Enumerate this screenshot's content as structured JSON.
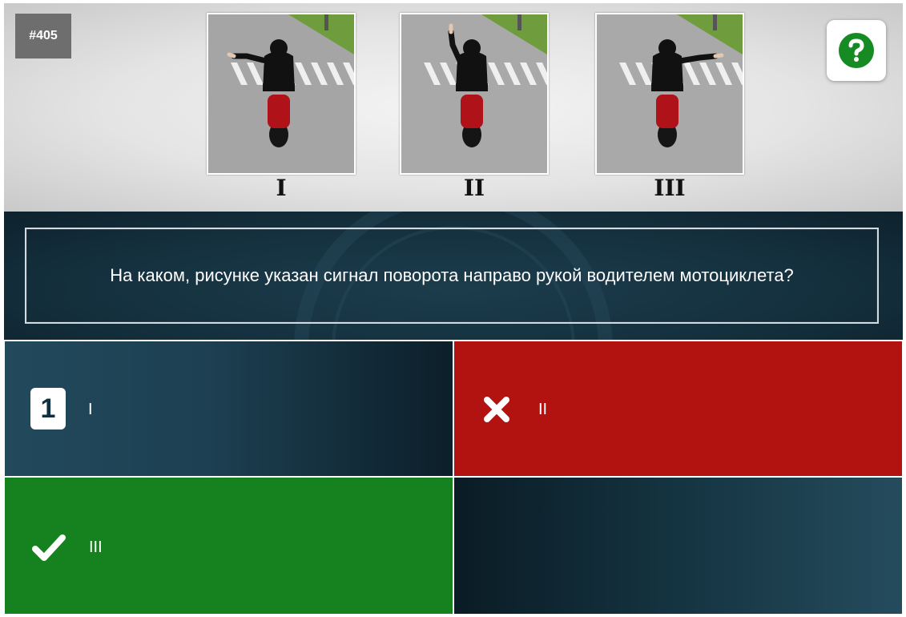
{
  "question": {
    "id": "#405",
    "text": "На каком, рисунке указан сигнал поворота направо рукой водителем мотоциклета?"
  },
  "images": [
    {
      "label": "I"
    },
    {
      "label": "II"
    },
    {
      "label": "III"
    }
  ],
  "answers": [
    {
      "number": "1",
      "text": "I",
      "state": "selected"
    },
    {
      "text": "II",
      "state": "wrong",
      "icon": "cross-icon"
    },
    {
      "text": "III",
      "state": "correct",
      "icon": "check-icon"
    },
    {
      "text": "",
      "state": "empty"
    }
  ],
  "help": {
    "icon": "question-icon"
  },
  "colors": {
    "correct": "#16821f",
    "wrong": "#b21210",
    "help_green": "#168a23",
    "panel_dark": "#15313f"
  }
}
